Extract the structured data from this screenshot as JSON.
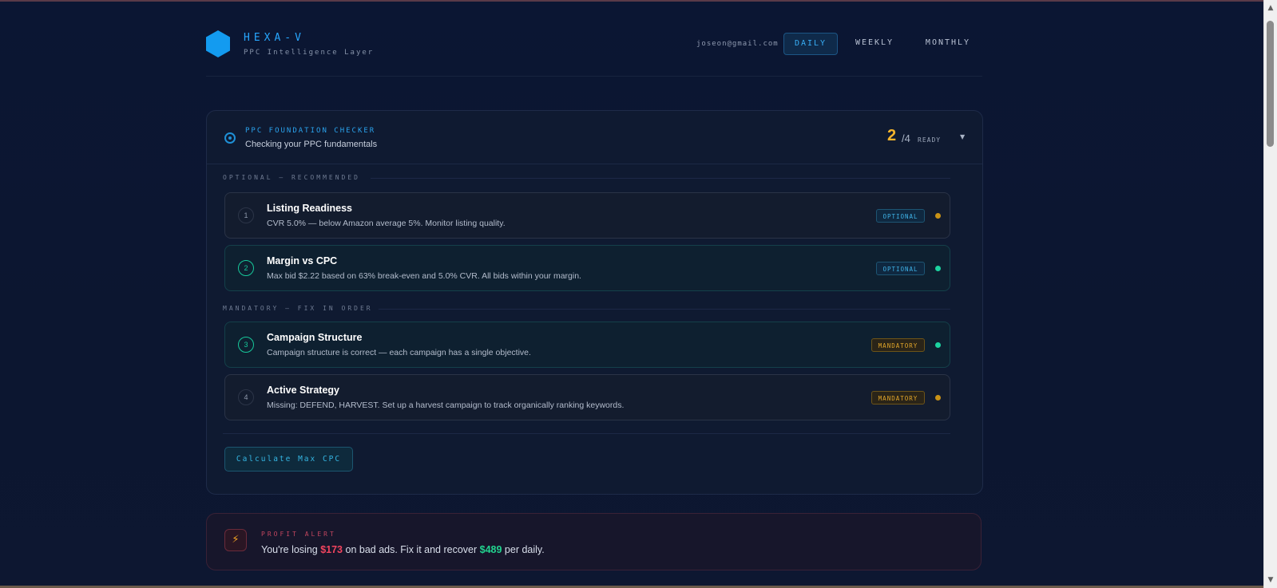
{
  "brand": {
    "name": "HEXA-V",
    "tagline": "PPC Intelligence Layer",
    "color": "#139bf0"
  },
  "header": {
    "email": "joseon@gmail.com",
    "periods": [
      {
        "label": "DAILY",
        "active": true
      },
      {
        "label": "WEEKLY",
        "active": false
      },
      {
        "label": "MONTHLY",
        "active": false
      }
    ]
  },
  "checker": {
    "title": "PPC FOUNDATION CHECKER",
    "subtitle": "Checking your PPC fundamentals",
    "ready_count": "2",
    "ready_total": "/4",
    "ready_label": "READY",
    "expand_icon": "caret-down-icon",
    "sections": [
      {
        "label": "OPTIONAL — RECOMMENDED",
        "items": [
          {
            "number": "1",
            "title": "Listing Readiness",
            "description": "CVR 5.0% — below Amazon average 5%. Monitor listing quality.",
            "badge": "OPTIONAL",
            "status": "warning",
            "status_color": "#c99216"
          },
          {
            "number": "2",
            "title": "Margin vs CPC",
            "description": "Max bid $2.22 based on 63% break-even and 5.0% CVR. All bids within your margin.",
            "badge": "OPTIONAL",
            "status": "ok",
            "status_color": "#1cd3a0"
          }
        ]
      },
      {
        "label": "MANDATORY — FIX IN ORDER",
        "items": [
          {
            "number": "3",
            "title": "Campaign Structure",
            "description": "Campaign structure is correct — each campaign has a single objective.",
            "badge": "MANDATORY",
            "status": "ok",
            "status_color": "#1cd3a0"
          },
          {
            "number": "4",
            "title": "Active Strategy",
            "description": "Missing: DEFEND, HARVEST. Set up a harvest campaign to track organically ranking keywords.",
            "badge": "MANDATORY",
            "status": "warning",
            "status_color": "#c99216"
          }
        ]
      }
    ],
    "calc_button": "Calculate Max CPC"
  },
  "alert": {
    "title": "PROFIT ALERT",
    "icon": "lightning-bolt-icon",
    "text_1": "You're losing ",
    "loss": "$173",
    "text_2": " on bad ads. Fix it and recover ",
    "gain": "$489",
    "text_3": " per daily."
  }
}
